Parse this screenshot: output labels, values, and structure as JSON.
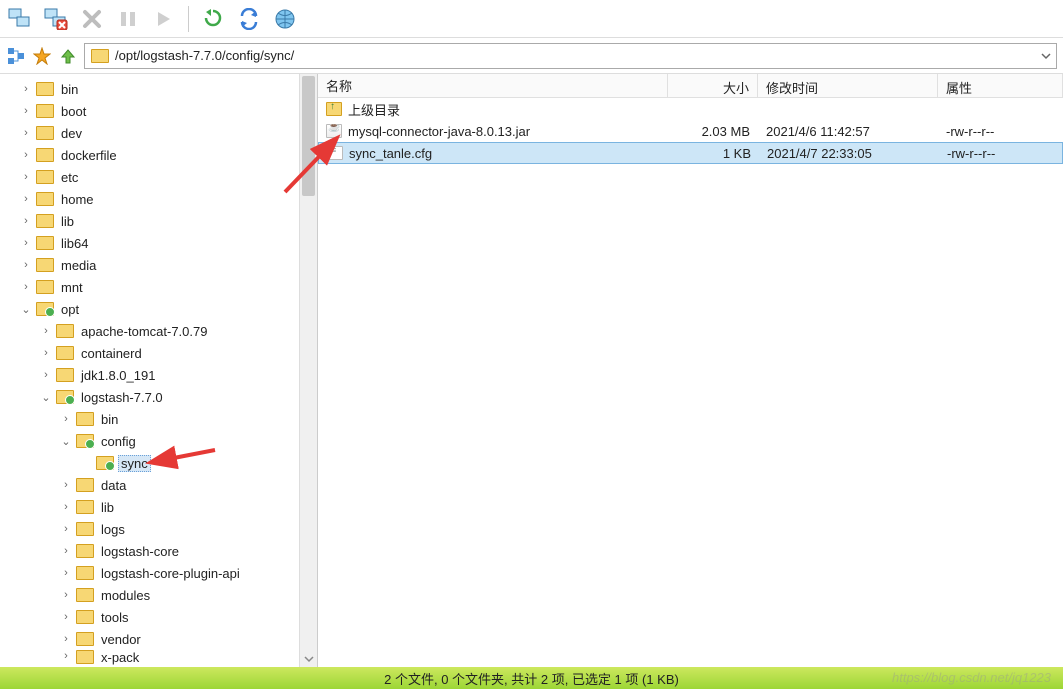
{
  "toolbar": {
    "icons": [
      "computers-icon",
      "disconnect-icon",
      "cancel-icon",
      "pause-icon",
      "play-icon",
      "refresh-down-icon",
      "refresh-cycle-icon",
      "globe-icon"
    ]
  },
  "addrbar": {
    "icons": [
      "tree-toggle-icon",
      "favorite-star-icon",
      "up-arrow-icon"
    ],
    "path": "/opt/logstash-7.7.0/config/sync/"
  },
  "tree": [
    {
      "depth": 0,
      "tw": ">",
      "green": false,
      "label": "bin"
    },
    {
      "depth": 0,
      "tw": ">",
      "green": false,
      "label": "boot"
    },
    {
      "depth": 0,
      "tw": ">",
      "green": false,
      "label": "dev"
    },
    {
      "depth": 0,
      "tw": ">",
      "green": false,
      "label": "dockerfile"
    },
    {
      "depth": 0,
      "tw": ">",
      "green": false,
      "label": "etc"
    },
    {
      "depth": 0,
      "tw": ">",
      "green": false,
      "label": "home"
    },
    {
      "depth": 0,
      "tw": ">",
      "green": false,
      "label": "lib"
    },
    {
      "depth": 0,
      "tw": ">",
      "green": false,
      "label": "lib64"
    },
    {
      "depth": 0,
      "tw": ">",
      "green": false,
      "label": "media"
    },
    {
      "depth": 0,
      "tw": ">",
      "green": false,
      "label": "mnt"
    },
    {
      "depth": 0,
      "tw": "v",
      "green": true,
      "label": "opt"
    },
    {
      "depth": 1,
      "tw": ">",
      "green": false,
      "label": "apache-tomcat-7.0.79"
    },
    {
      "depth": 1,
      "tw": ">",
      "green": false,
      "label": "containerd"
    },
    {
      "depth": 1,
      "tw": ">",
      "green": false,
      "label": "jdk1.8.0_191"
    },
    {
      "depth": 1,
      "tw": "v",
      "green": true,
      "label": "logstash-7.7.0"
    },
    {
      "depth": 2,
      "tw": ">",
      "green": false,
      "label": "bin"
    },
    {
      "depth": 2,
      "tw": "v",
      "green": true,
      "label": "config"
    },
    {
      "depth": 3,
      "tw": "",
      "green": true,
      "label": "sync",
      "selected": true
    },
    {
      "depth": 2,
      "tw": ">",
      "green": false,
      "label": "data"
    },
    {
      "depth": 2,
      "tw": ">",
      "green": false,
      "label": "lib"
    },
    {
      "depth": 2,
      "tw": ">",
      "green": false,
      "label": "logs"
    },
    {
      "depth": 2,
      "tw": ">",
      "green": false,
      "label": "logstash-core"
    },
    {
      "depth": 2,
      "tw": ">",
      "green": false,
      "label": "logstash-core-plugin-api"
    },
    {
      "depth": 2,
      "tw": ">",
      "green": false,
      "label": "modules"
    },
    {
      "depth": 2,
      "tw": ">",
      "green": false,
      "label": "tools"
    },
    {
      "depth": 2,
      "tw": ">",
      "green": false,
      "label": "vendor"
    },
    {
      "depth": 2,
      "tw": ">",
      "green": false,
      "label": "x-pack",
      "cut": true
    }
  ],
  "columns": {
    "name": "名称",
    "size": "大小",
    "date": "修改时间",
    "attr": "属性"
  },
  "files": {
    "parent": {
      "label": "上级目录"
    },
    "rows": [
      {
        "icon": "jar",
        "name": "mysql-connector-java-8.0.13.jar",
        "size": "2.03 MB",
        "date": "2021/4/6 11:42:57",
        "attr": "-rw-r--r--",
        "selected": false
      },
      {
        "icon": "cfg",
        "name": "sync_tanle.cfg",
        "size": "1 KB",
        "date": "2021/4/7 22:33:05",
        "attr": "-rw-r--r--",
        "selected": true
      }
    ]
  },
  "status": "2 个文件, 0 个文件夹, 共计 2 项, 已选定 1 项 (1 KB)",
  "watermark": "https://blog.csdn.net/jq1223"
}
